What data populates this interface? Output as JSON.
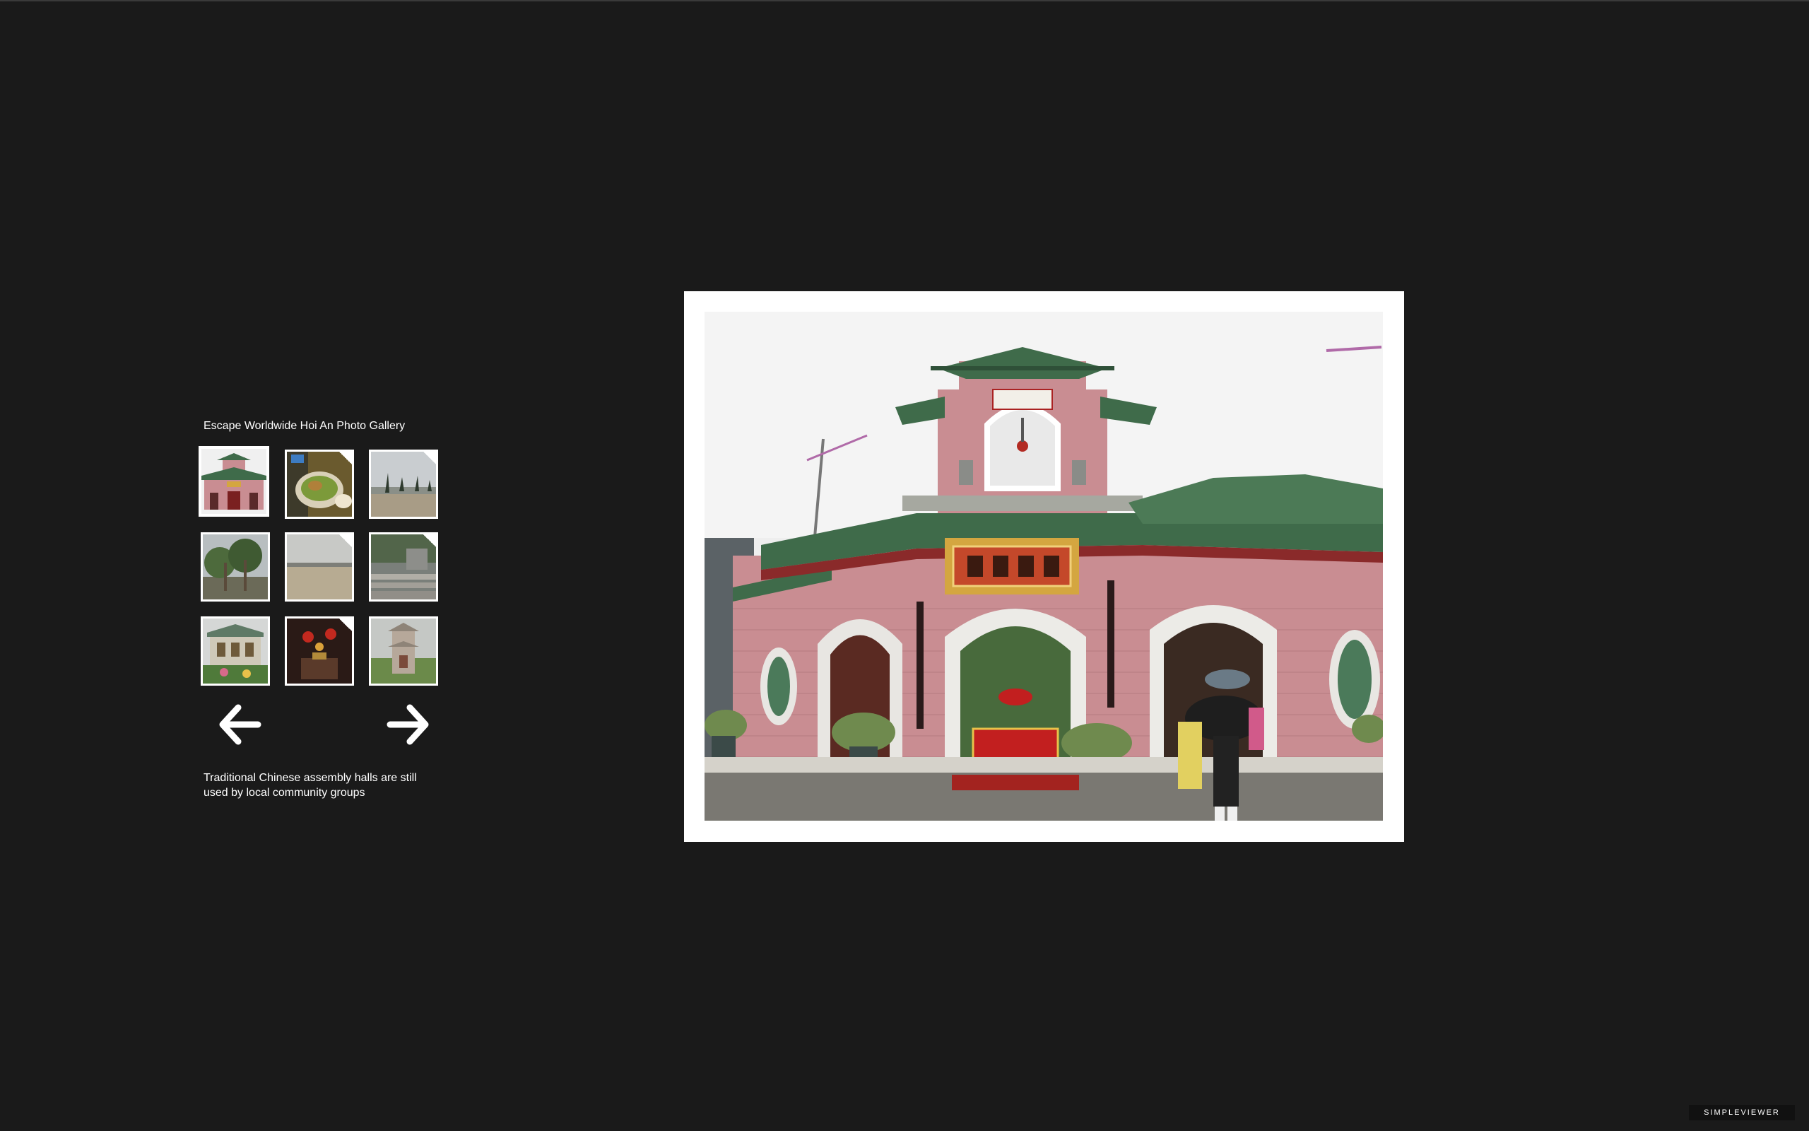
{
  "gallery": {
    "title": "Escape Worldwide Hoi An Photo Gallery",
    "caption": "Traditional Chinese assembly halls are still used by local community groups",
    "thumbnails": [
      {
        "subject": "temple gate",
        "selected": true
      },
      {
        "subject": "food plate",
        "selected": false
      },
      {
        "subject": "beach palms",
        "selected": false
      },
      {
        "subject": "palm trees",
        "selected": false
      },
      {
        "subject": "sandy beach",
        "selected": false
      },
      {
        "subject": "stone steps",
        "selected": false
      },
      {
        "subject": "assembly hall",
        "selected": false
      },
      {
        "subject": "lanterns interior",
        "selected": false
      },
      {
        "subject": "pagoda tower",
        "selected": false
      }
    ],
    "prev_icon": "arrow-left-icon",
    "next_icon": "arrow-right-icon"
  },
  "viewer": {
    "brand": "SIMPLEVIEWER"
  },
  "colors": {
    "background": "#1a1a1a",
    "frame": "#ffffff",
    "text": "#ffffff",
    "wall": "#c98d92",
    "roof": "#3f6b4a"
  }
}
